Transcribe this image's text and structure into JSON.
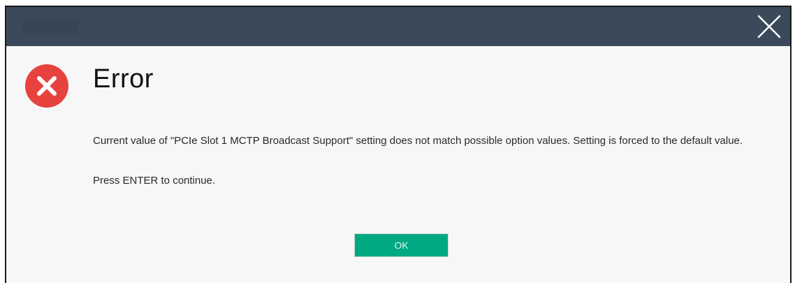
{
  "dialog": {
    "title": "Error",
    "message": "Current value of \"PCIe Slot 1 MCTP Broadcast Support\" setting does not match possible option values. Setting is forced to the default value.",
    "prompt": "Press ENTER to continue.",
    "ok_label": "OK",
    "icons": {
      "close": "close-icon",
      "error": "error-icon"
    },
    "colors": {
      "titlebar": "#3a4a5a",
      "error_icon": "#e8423f",
      "ok_button": "#01a982",
      "background": "#f7f7f7"
    }
  }
}
